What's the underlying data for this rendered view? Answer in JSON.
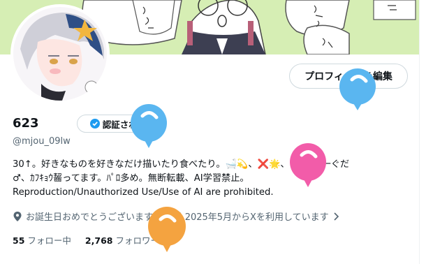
{
  "profile": {
    "display_name": "623",
    "verify_label": "認証される",
    "handle": "@mjou_09lw",
    "edit_label": "プロフィールを編集",
    "bio_lines": [
      "30↑。好きなものを好きなだけ描いたり食べたり。🛁💫、❌🌟、🔦🧡、一ぐだ",
      "♂、ｶﾌｷｮｳ齧ってます。ﾊﾟﾛ多め。無断転載、AI学習禁止。",
      "Reproduction/Unauthorized Use/Use of AI are prohibited."
    ],
    "birthday_text": "お誕生日おめでとうございます。",
    "joined_text": "2025年5月からXを利用しています",
    "following_count": "55",
    "following_label": "フォロー中",
    "followers_count": "2,768",
    "followers_label": "フォロワー"
  },
  "icons": {
    "location": "location-pin-icon",
    "calendar": "calendar-icon",
    "verified": "verified-check-icon",
    "chevron": "chevron-right-icon"
  },
  "colors": {
    "banner_bg": "#d9efb8",
    "verified_blue": "#1d9bf0",
    "text_secondary": "#536471",
    "balloon_blue": "#5ab6f0",
    "balloon_pink": "#f25ca9",
    "balloon_orange": "#f4a340"
  }
}
